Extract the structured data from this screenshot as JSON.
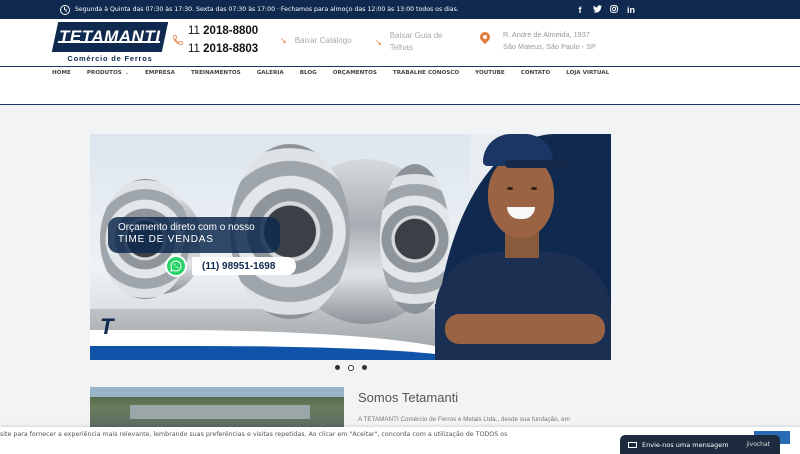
{
  "topbar": {
    "hours": "Segunda à Quinta das 07:30 às 17:30. Sexta das 07:30 às 17:00 · Fechamos para almoço das 12:00 às 13:00 todos os dias.",
    "social": [
      "facebook-icon",
      "twitter-icon",
      "instagram-icon",
      "linkedin-icon"
    ]
  },
  "header": {
    "logo_name": "TETAMANTI",
    "logo_sub": "Comércio de Ferros",
    "phone1_ddd": "11",
    "phone1_num": "2018-8800",
    "phone2_ddd": "11",
    "phone2_num": "2018-8803",
    "catalog_label": "Baixar Catálogo",
    "guide_label_line1": "Baixar Guia de",
    "guide_label_line2": "Telhas",
    "address_line1": "R. André de Almeida, 1937",
    "address_line2": "São Mateus, São Paulo - SP"
  },
  "nav": {
    "items": [
      "HOME",
      "PRODUTOS",
      "EMPRESA",
      "TREINAMENTOS",
      "GALERIA",
      "BLOG",
      "ORÇAMENTOS",
      "TRABALHE CONOSCO",
      "YOUTUBE",
      "CONTATO",
      "LOJA VIRTUAL"
    ]
  },
  "banner": {
    "line1": "Orçamento direto com o nosso",
    "line2": "TIME DE VENDAS",
    "whatsapp": "(11) 98951-1698",
    "slides": 3,
    "active_slide": 2
  },
  "about": {
    "title": "Somos Tetamanti",
    "text": "A TETAMANTI Comércio de Ferros e Metais Ltda., desde sua fundação, em"
  },
  "cookie": {
    "text": "site para fornecer a experiência mais relevante, lembrando suas preferências e visitas repetidas. Ao clicar em \"Aceitar\", concorda com a utilização de TODOS os"
  },
  "chat": {
    "label": "Envie-nos uma mensagem",
    "brand": "jivochat"
  }
}
